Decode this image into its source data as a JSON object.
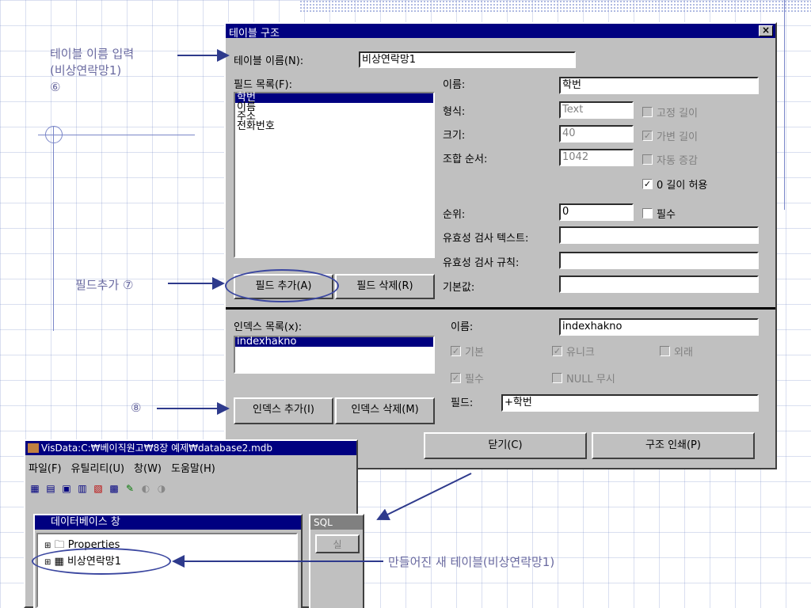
{
  "callouts": {
    "c1_line1": "테이블 이름 입력",
    "c1_line2": "(비상연락망1)",
    "c1_num": "⑥",
    "c2": "필드추가 ⑦",
    "c3": "⑧",
    "c4": "만들어진 새 테이블(비상연락망1)"
  },
  "dialog": {
    "title": "테이블 구조",
    "close": "×",
    "table_name_label": "테이블 이름(N):",
    "table_name_value": "비상연락망1",
    "field_list_label": "필드 목록(F):",
    "fields": [
      "학번",
      "이름",
      "주소",
      "전화번호"
    ],
    "selected_field": "학번",
    "name_label": "이름:",
    "name_value": "학번",
    "type_label": "형식:",
    "type_value": "Text",
    "size_label": "크기:",
    "size_value": "40",
    "collate_label": "조합 순서:",
    "collate_value": "1042",
    "fixed_len": "고정 길이",
    "variable_len": "가변 길이",
    "auto_inc": "자동 증감",
    "allow_zero": "0 길이 허용",
    "order_label": "순위:",
    "order_value": "0",
    "required": "필수",
    "valid_text_label": "유효성 검사 텍스트:",
    "valid_rule_label": "유효성 검사 규칙:",
    "default_label": "기본값:",
    "add_field": "필드 추가(A)",
    "remove_field": "필드 삭제(R)",
    "index_list_label": "인덱스 목록(x):",
    "indexes": [
      "indexhakno"
    ],
    "idx_name_label": "이름:",
    "idx_name_value": "indexhakno",
    "primary": "기본",
    "unique": "유니크",
    "foreign": "외래",
    "idx_required": "필수",
    "ignore_null": "NULL 무시",
    "idx_fields_label": "필드:",
    "idx_fields_value": "+학번",
    "add_index": "인덱스 추가(I)",
    "remove_index": "인덱스 삭제(M)",
    "close_btn": "닫기(C)",
    "print_btn": "구조 인쇄(P)"
  },
  "visdata": {
    "title": "VisData:C:₩베이직원고₩8장 예제₩database2.mdb",
    "menus": [
      "파일(F)",
      "유틸리티(U)",
      "창(W)",
      "도움말(H)"
    ],
    "db_window_title": "데이터베이스 창",
    "tree_items": [
      "Properties",
      "비상연락망1"
    ],
    "sql_title": "SQL",
    "sql_btn": "실"
  }
}
